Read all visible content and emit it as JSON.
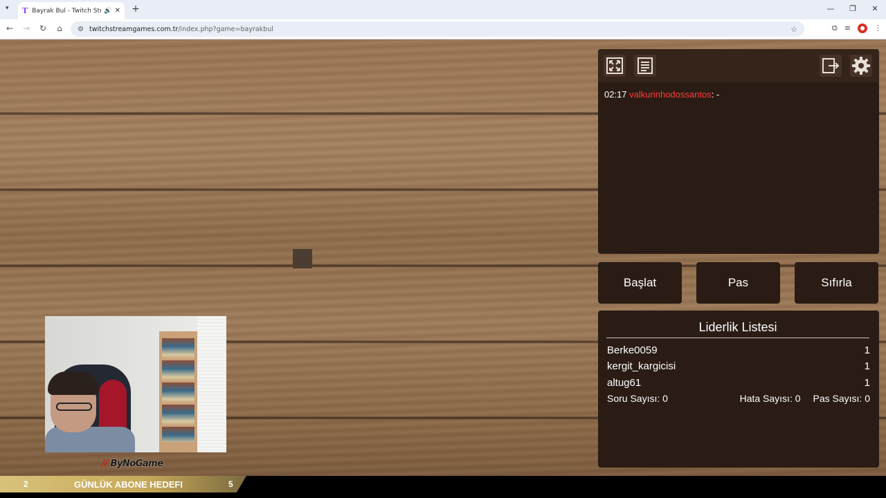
{
  "browser": {
    "tab_title": "Bayrak Bul - Twitch Stream",
    "tab_favicon": "T",
    "url_host": "twitchstreamgames.com.tr",
    "url_path": "/index.php?game=bayrakbul",
    "icons": {
      "tab_dropdown": "chevron-down-icon",
      "audio": "speaker-icon",
      "close": "close-icon",
      "new_tab": "plus-icon",
      "back": "arrow-left-icon",
      "forward": "arrow-right-icon",
      "reload": "reload-icon",
      "home": "home-icon",
      "site_info": "tune-icon",
      "bookmark": "star-icon",
      "extensions": "puzzle-icon",
      "media": "media-icon",
      "profile_ext": "red-circle-icon",
      "menu": "kebab-icon"
    }
  },
  "game": {
    "chat": {
      "time": "02:17",
      "user": "valkurinhodossantos",
      "message": ": -"
    },
    "toolbar_icons": [
      "fullscreen-icon",
      "notes-icon",
      "logout-icon",
      "gear-icon"
    ],
    "buttons": {
      "start": "Başlat",
      "pass": "Pas",
      "reset": "Sıfırla"
    },
    "leaderboard": {
      "title": "Liderlik Listesi",
      "rows": [
        {
          "name": "Berke0059",
          "score": "1"
        },
        {
          "name": "kergit_kargicisi",
          "score": "1"
        },
        {
          "name": "altug61",
          "score": "1"
        }
      ],
      "stats": {
        "questions": "Soru Sayısı: 0",
        "errors": "Hata Sayısı: 0",
        "passes": "Pas Sayısı: 0"
      }
    },
    "colors": {
      "panel": "#2a1c14",
      "chat_user": "#ff3b3b"
    }
  },
  "overlay": {
    "logo": "ByNoGame",
    "sub_goal": {
      "current": "2",
      "label": "GÜNLÜK ABONE HEDEFI",
      "goal": "5"
    }
  }
}
